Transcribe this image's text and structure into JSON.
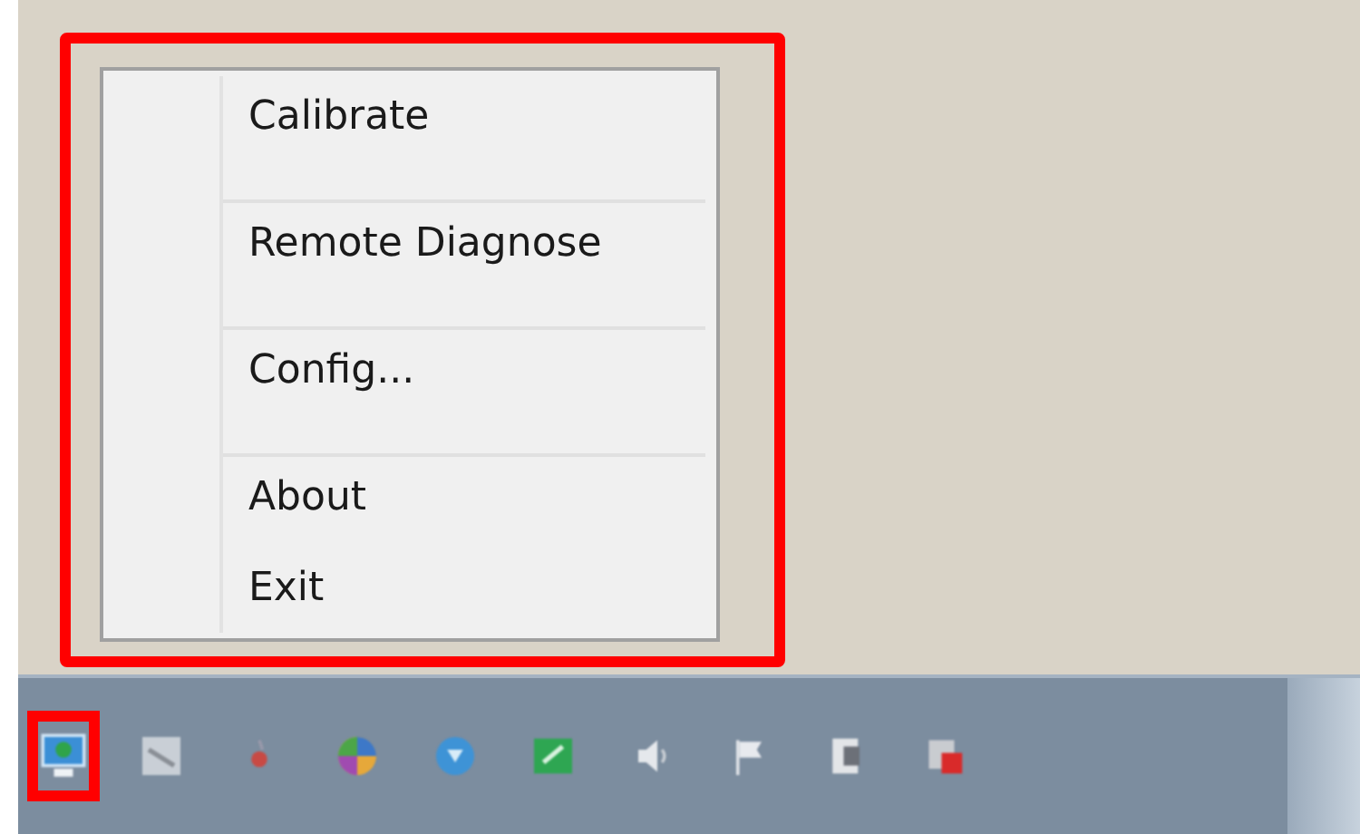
{
  "context_menu": {
    "highlighted": true,
    "groups": [
      {
        "items": [
          "Calibrate"
        ]
      },
      {
        "items": [
          "Remote Diagnose"
        ]
      },
      {
        "items": [
          "Config..."
        ]
      },
      {
        "items": [
          "About",
          "Exit"
        ]
      }
    ]
  },
  "tray_icons": [
    {
      "kind": "monitor",
      "highlighted": true
    },
    {
      "kind": "tile",
      "highlighted": false
    },
    {
      "kind": "dot",
      "highlighted": false
    },
    {
      "kind": "wheel",
      "highlighted": false
    },
    {
      "kind": "shield",
      "highlighted": false
    },
    {
      "kind": "check",
      "highlighted": false
    },
    {
      "kind": "speaker",
      "highlighted": false
    },
    {
      "kind": "flag",
      "highlighted": false
    },
    {
      "kind": "sheet",
      "highlighted": false
    },
    {
      "kind": "redsheet",
      "highlighted": false
    }
  ]
}
